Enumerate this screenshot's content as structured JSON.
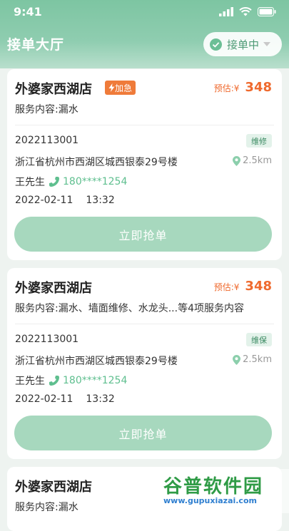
{
  "status": {
    "time": "9:41"
  },
  "header": {
    "title": "接单大厅",
    "toggle_label": "接单中"
  },
  "orders": [
    {
      "shop": "外婆家西湖店",
      "urgent": "加急",
      "estimate_label": "预估:¥",
      "estimate_value": "348",
      "service": "服务内容:漏水",
      "order_no": "2022113001",
      "tag": "维修",
      "address": "浙江省杭州市西湖区城西银泰29号楼",
      "distance": "2.5km",
      "contact_name": "王先生",
      "phone": "180****1254",
      "date": "2022-02-11",
      "time": "13:32",
      "button": "立即抢单"
    },
    {
      "shop": "外婆家西湖店",
      "estimate_label": "预估:¥",
      "estimate_value": "348",
      "service": "服务内容:漏水、墙面维修、水龙头...等4项服务内容",
      "order_no": "2022113001",
      "tag": "维保",
      "address": "浙江省杭州市西湖区城西银泰29号楼",
      "distance": "2.5km",
      "contact_name": "王先生",
      "phone": "180****1254",
      "date": "2022-02-11",
      "time": "13:32",
      "button": "立即抢单"
    },
    {
      "shop": "外婆家西湖店",
      "service": "服务内容:漏水"
    }
  ],
  "watermark": {
    "title": "谷普软件园",
    "url": "www.gupuxiazai.com"
  },
  "colors": {
    "accent": "#7dc5a2",
    "button": "#a7d8be",
    "price": "#ef6a2e",
    "urgent": "#ef7b3a",
    "phone": "#5fbf8f"
  }
}
